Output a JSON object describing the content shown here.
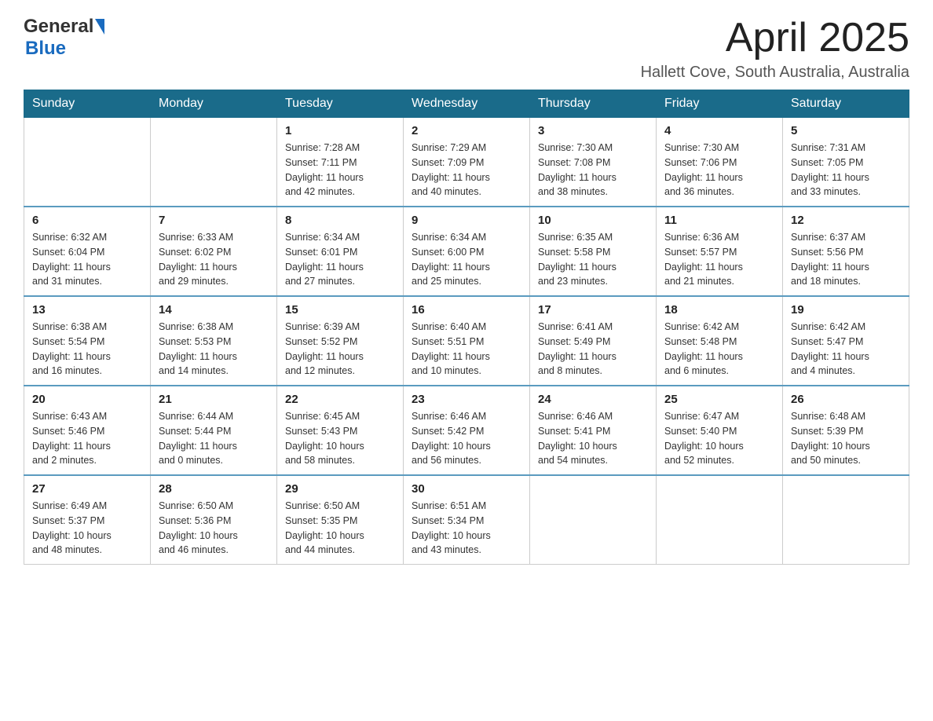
{
  "header": {
    "logo": {
      "general": "General",
      "blue": "Blue"
    },
    "title": "April 2025",
    "location": "Hallett Cove, South Australia, Australia"
  },
  "days_of_week": [
    "Sunday",
    "Monday",
    "Tuesday",
    "Wednesday",
    "Thursday",
    "Friday",
    "Saturday"
  ],
  "weeks": [
    [
      {
        "day": "",
        "info": ""
      },
      {
        "day": "",
        "info": ""
      },
      {
        "day": "1",
        "info": "Sunrise: 7:28 AM\nSunset: 7:11 PM\nDaylight: 11 hours\nand 42 minutes."
      },
      {
        "day": "2",
        "info": "Sunrise: 7:29 AM\nSunset: 7:09 PM\nDaylight: 11 hours\nand 40 minutes."
      },
      {
        "day": "3",
        "info": "Sunrise: 7:30 AM\nSunset: 7:08 PM\nDaylight: 11 hours\nand 38 minutes."
      },
      {
        "day": "4",
        "info": "Sunrise: 7:30 AM\nSunset: 7:06 PM\nDaylight: 11 hours\nand 36 minutes."
      },
      {
        "day": "5",
        "info": "Sunrise: 7:31 AM\nSunset: 7:05 PM\nDaylight: 11 hours\nand 33 minutes."
      }
    ],
    [
      {
        "day": "6",
        "info": "Sunrise: 6:32 AM\nSunset: 6:04 PM\nDaylight: 11 hours\nand 31 minutes."
      },
      {
        "day": "7",
        "info": "Sunrise: 6:33 AM\nSunset: 6:02 PM\nDaylight: 11 hours\nand 29 minutes."
      },
      {
        "day": "8",
        "info": "Sunrise: 6:34 AM\nSunset: 6:01 PM\nDaylight: 11 hours\nand 27 minutes."
      },
      {
        "day": "9",
        "info": "Sunrise: 6:34 AM\nSunset: 6:00 PM\nDaylight: 11 hours\nand 25 minutes."
      },
      {
        "day": "10",
        "info": "Sunrise: 6:35 AM\nSunset: 5:58 PM\nDaylight: 11 hours\nand 23 minutes."
      },
      {
        "day": "11",
        "info": "Sunrise: 6:36 AM\nSunset: 5:57 PM\nDaylight: 11 hours\nand 21 minutes."
      },
      {
        "day": "12",
        "info": "Sunrise: 6:37 AM\nSunset: 5:56 PM\nDaylight: 11 hours\nand 18 minutes."
      }
    ],
    [
      {
        "day": "13",
        "info": "Sunrise: 6:38 AM\nSunset: 5:54 PM\nDaylight: 11 hours\nand 16 minutes."
      },
      {
        "day": "14",
        "info": "Sunrise: 6:38 AM\nSunset: 5:53 PM\nDaylight: 11 hours\nand 14 minutes."
      },
      {
        "day": "15",
        "info": "Sunrise: 6:39 AM\nSunset: 5:52 PM\nDaylight: 11 hours\nand 12 minutes."
      },
      {
        "day": "16",
        "info": "Sunrise: 6:40 AM\nSunset: 5:51 PM\nDaylight: 11 hours\nand 10 minutes."
      },
      {
        "day": "17",
        "info": "Sunrise: 6:41 AM\nSunset: 5:49 PM\nDaylight: 11 hours\nand 8 minutes."
      },
      {
        "day": "18",
        "info": "Sunrise: 6:42 AM\nSunset: 5:48 PM\nDaylight: 11 hours\nand 6 minutes."
      },
      {
        "day": "19",
        "info": "Sunrise: 6:42 AM\nSunset: 5:47 PM\nDaylight: 11 hours\nand 4 minutes."
      }
    ],
    [
      {
        "day": "20",
        "info": "Sunrise: 6:43 AM\nSunset: 5:46 PM\nDaylight: 11 hours\nand 2 minutes."
      },
      {
        "day": "21",
        "info": "Sunrise: 6:44 AM\nSunset: 5:44 PM\nDaylight: 11 hours\nand 0 minutes."
      },
      {
        "day": "22",
        "info": "Sunrise: 6:45 AM\nSunset: 5:43 PM\nDaylight: 10 hours\nand 58 minutes."
      },
      {
        "day": "23",
        "info": "Sunrise: 6:46 AM\nSunset: 5:42 PM\nDaylight: 10 hours\nand 56 minutes."
      },
      {
        "day": "24",
        "info": "Sunrise: 6:46 AM\nSunset: 5:41 PM\nDaylight: 10 hours\nand 54 minutes."
      },
      {
        "day": "25",
        "info": "Sunrise: 6:47 AM\nSunset: 5:40 PM\nDaylight: 10 hours\nand 52 minutes."
      },
      {
        "day": "26",
        "info": "Sunrise: 6:48 AM\nSunset: 5:39 PM\nDaylight: 10 hours\nand 50 minutes."
      }
    ],
    [
      {
        "day": "27",
        "info": "Sunrise: 6:49 AM\nSunset: 5:37 PM\nDaylight: 10 hours\nand 48 minutes."
      },
      {
        "day": "28",
        "info": "Sunrise: 6:50 AM\nSunset: 5:36 PM\nDaylight: 10 hours\nand 46 minutes."
      },
      {
        "day": "29",
        "info": "Sunrise: 6:50 AM\nSunset: 5:35 PM\nDaylight: 10 hours\nand 44 minutes."
      },
      {
        "day": "30",
        "info": "Sunrise: 6:51 AM\nSunset: 5:34 PM\nDaylight: 10 hours\nand 43 minutes."
      },
      {
        "day": "",
        "info": ""
      },
      {
        "day": "",
        "info": ""
      },
      {
        "day": "",
        "info": ""
      }
    ]
  ]
}
